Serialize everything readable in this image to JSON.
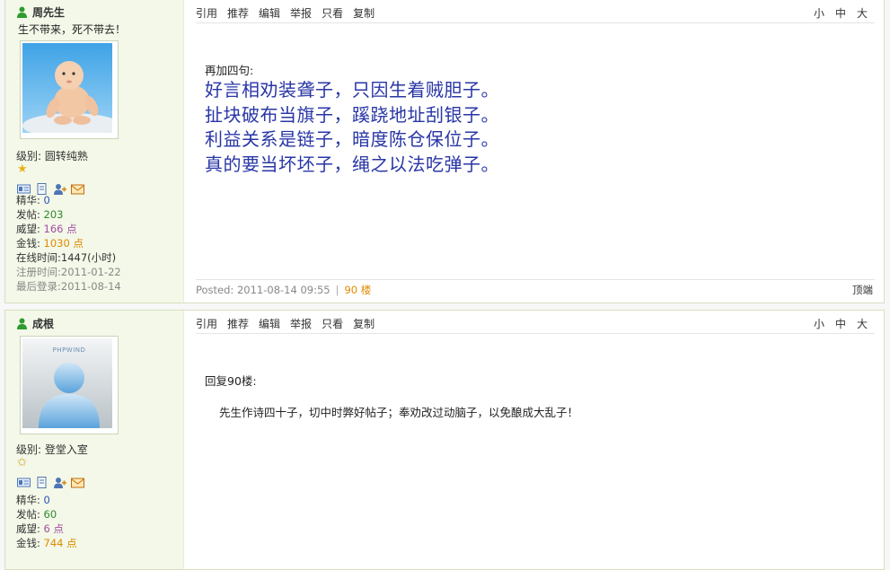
{
  "posts": [
    {
      "username": "周先生",
      "signature": "生不带来，死不带去！",
      "level_label": "级别:",
      "level": "圆转纯熟",
      "stats": {
        "jinghua_label": "精华:",
        "jinghua": "0",
        "fatie_label": "发帖:",
        "fatie": "203",
        "weiwang_label": "威望:",
        "weiwang": "166 点",
        "jinqian_label": "金钱:",
        "jinqian": "1030 点",
        "online": "在线时间:1447(小时)",
        "registered": "注册时间:2011-01-22",
        "last_login": "最后登录:2011-08-14"
      },
      "actions": [
        "引用",
        "推荐",
        "编辑",
        "举报",
        "只看",
        "复制"
      ],
      "sizes": [
        "小",
        "中",
        "大"
      ],
      "intro": "再加四句:",
      "lines": [
        "好言相劝装聋子，只因生着贼胆子。",
        "扯块破布当旗子，蹊跷地址刮银子。",
        "利益关系是链子，暗度陈仓保位子。",
        "真的要当坏坯子，绳之以法吃弹子。"
      ],
      "posted": "Posted: 2011-08-14 09:55",
      "separator": "|",
      "floor": "90 楼",
      "top_link": "顶端"
    },
    {
      "username": "成根",
      "avatar_text": "PHPWIND",
      "level_label": "级别:",
      "level": "登堂入室",
      "stats": {
        "jinghua_label": "精华:",
        "jinghua": "0",
        "fatie_label": "发帖:",
        "fatie": "60",
        "weiwang_label": "威望:",
        "weiwang": "6 点",
        "jinqian_label": "金钱:",
        "jinqian": "744 点"
      },
      "actions": [
        "引用",
        "推荐",
        "编辑",
        "举报",
        "只看",
        "复制"
      ],
      "sizes": [
        "小",
        "中",
        "大"
      ],
      "reply_to": "回复90楼:",
      "body": "先生作诗四十子，切中时弊好帖子；奉劝改过动脑子，以免酿成大乱子！"
    }
  ],
  "colors": {
    "sidebar_bg": "#f3f8e8",
    "poem_blue": "#2936a6",
    "floor_orange": "#e08a00"
  },
  "icons": [
    "person-icon",
    "profile-card-icon",
    "document-icon",
    "add-friend-icon",
    "message-icon",
    "star-icon"
  ]
}
